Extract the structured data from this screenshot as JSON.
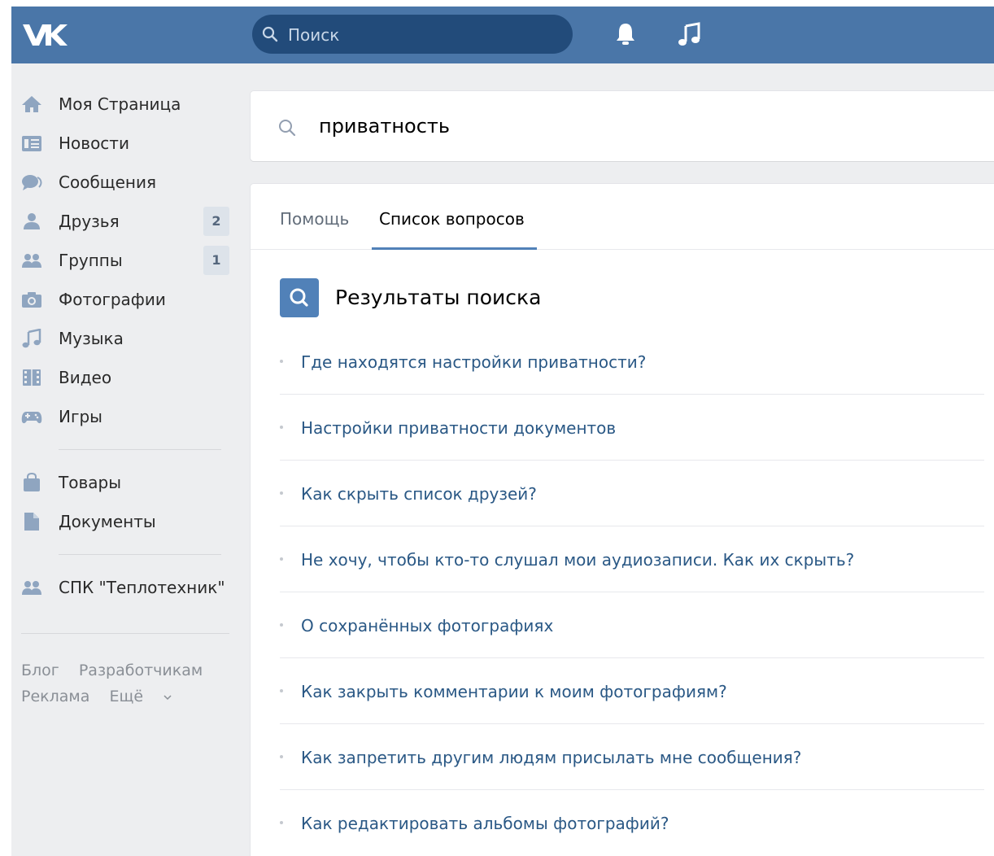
{
  "header": {
    "search_placeholder": "Поиск"
  },
  "sidebar": {
    "items": [
      {
        "label": "Моя Страница",
        "icon": "home-icon"
      },
      {
        "label": "Новости",
        "icon": "news-icon"
      },
      {
        "label": "Сообщения",
        "icon": "messages-icon"
      },
      {
        "label": "Друзья",
        "icon": "friends-icon",
        "count": "2"
      },
      {
        "label": "Группы",
        "icon": "groups-icon",
        "count": "1"
      },
      {
        "label": "Фотографии",
        "icon": "camera-icon"
      },
      {
        "label": "Музыка",
        "icon": "music-icon"
      },
      {
        "label": "Видео",
        "icon": "video-icon"
      },
      {
        "label": "Игры",
        "icon": "gamepad-icon"
      }
    ],
    "items2": [
      {
        "label": "Товары",
        "icon": "bag-icon"
      },
      {
        "label": "Документы",
        "icon": "document-icon"
      }
    ],
    "items3": [
      {
        "label": "СПК \"Теплотехник\"",
        "icon": "groups-icon"
      }
    ],
    "footer": {
      "blog": "Блог",
      "developers": "Разработчикам",
      "ads": "Реклама",
      "more": "Ещё"
    }
  },
  "main": {
    "query": "приватность",
    "tabs": [
      {
        "label": "Помощь"
      },
      {
        "label": "Список вопросов",
        "active": true
      }
    ],
    "results_title": "Результаты поиска",
    "results": [
      "Где находятся настройки приватности?",
      "Настройки приватности документов",
      "Как скрыть список друзей?",
      "Не хочу, чтобы кто-то слушал мои аудиозаписи. Как их скрыть?",
      "О сохранённых фотографиях",
      "Как закрыть комментарии к моим фотографиям?",
      "Как запретить другим людям присылать мне сообщения?",
      "Как редактировать альбомы фотографий?"
    ]
  },
  "colors": {
    "header": "#4a76a8",
    "accent": "#5181b8",
    "link": "#2a5885",
    "background": "#edeef0"
  }
}
